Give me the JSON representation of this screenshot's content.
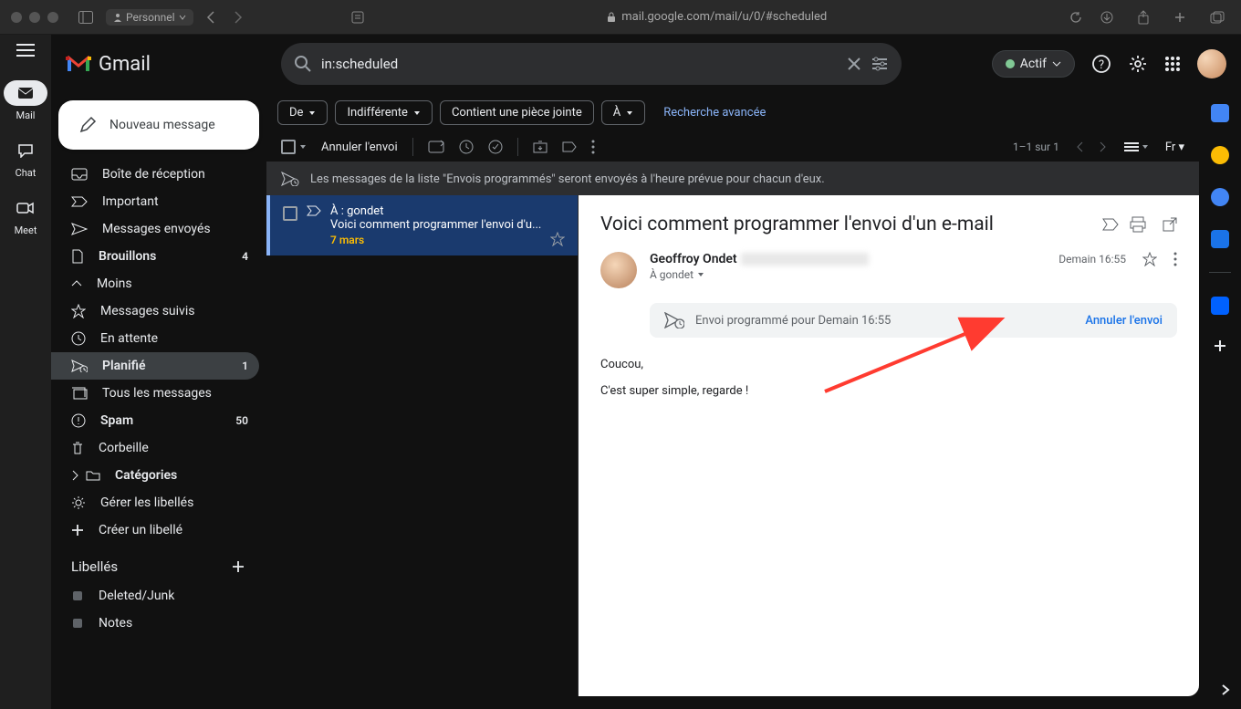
{
  "browser": {
    "profile": "Personnel",
    "url": "mail.google.com/mail/u/0/#scheduled"
  },
  "app": {
    "logo": "Gmail",
    "search": "in:scheduled",
    "status": "Actif"
  },
  "rail": {
    "mail": "Mail",
    "chat": "Chat",
    "meet": "Meet"
  },
  "sidebar": {
    "compose": "Nouveau message",
    "items": [
      {
        "label": "Boîte de réception"
      },
      {
        "label": "Important"
      },
      {
        "label": "Messages envoyés"
      },
      {
        "label": "Brouillons",
        "count": "4"
      },
      {
        "label": "Moins"
      },
      {
        "label": "Messages suivis"
      },
      {
        "label": "En attente"
      },
      {
        "label": "Planifié",
        "count": "1"
      },
      {
        "label": "Tous les messages"
      },
      {
        "label": "Spam",
        "count": "50"
      },
      {
        "label": "Corbeille"
      },
      {
        "label": "Catégories"
      },
      {
        "label": "Gérer les libellés"
      },
      {
        "label": "Créer un libellé"
      }
    ],
    "labels_head": "Libellés",
    "labels": [
      {
        "label": "Deleted/Junk"
      },
      {
        "label": "Notes"
      }
    ]
  },
  "filters": {
    "from": "De",
    "anytime": "Indifférente",
    "attachment": "Contient une pièce jointe",
    "to": "À",
    "advanced": "Recherche avancée"
  },
  "toolbar": {
    "cancel": "Annuler l'envoi",
    "pagination": "1–1 sur 1"
  },
  "banner": "Les messages de la liste \"Envois programmés\" seront envoyés à l'heure prévue pour chacun d'eux.",
  "message": {
    "to": "À : gondet",
    "subject": "Voici comment programmer l'envoi d'u...",
    "date": "7 mars"
  },
  "reader": {
    "title": "Voici comment programmer l'envoi d'un e-mail",
    "from_name": "Geoffroy Ondet",
    "to": "À gondet",
    "when": "Demain 16:55",
    "scheduled": "Envoi programmé pour Demain 16:55",
    "cancel": "Annuler l'envoi",
    "body1": "Coucou,",
    "body2": "C'est super simple, regarde !"
  }
}
